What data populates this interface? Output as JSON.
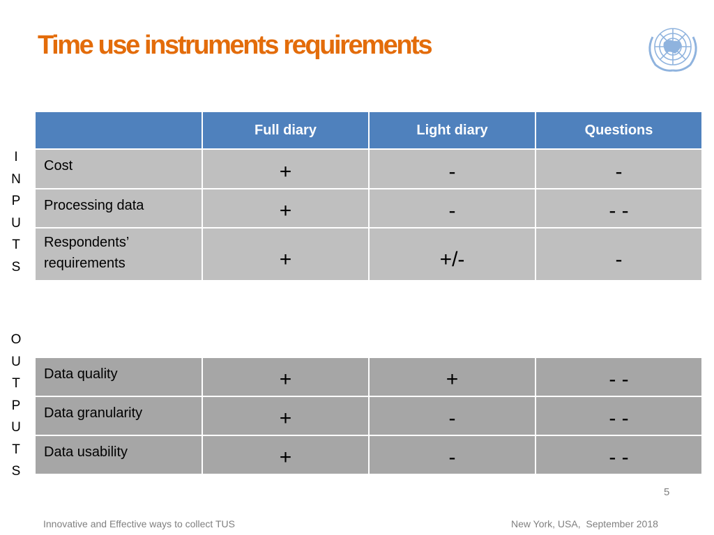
{
  "slide": {
    "title": "Time use instruments requirements",
    "logo_icon": "un-emblem-icon",
    "page_number": "5",
    "footer_left": "Innovative and Effective ways to collect TUS",
    "footer_right": "New York, USA,  September 2018",
    "title_color": "#e36c0a",
    "header_color": "#4f81bd"
  },
  "table": {
    "columns": [
      "",
      "Full diary",
      "Light diary",
      "Questions"
    ],
    "inputs": {
      "side_label": [
        "I",
        "N",
        "P",
        "U",
        "T",
        "S"
      ],
      "rows": [
        {
          "label": "Cost",
          "full": "+",
          "light": "-",
          "questions": "-"
        },
        {
          "label": "Processing data",
          "full": "+",
          "light": "-",
          "questions": "- -"
        },
        {
          "label": "Respondents’ requirements",
          "full": "+",
          "light": "+/-",
          "questions": "-"
        }
      ]
    },
    "outputs": {
      "side_label": [
        "O",
        "U",
        "T",
        "P",
        "U",
        "T",
        "S"
      ],
      "rows": [
        {
          "label": "Data quality",
          "full": "+",
          "light": "+",
          "questions": "- -"
        },
        {
          "label": "Data granularity",
          "full": "+",
          "light": "-",
          "questions": "- -"
        },
        {
          "label": "Data usability",
          "full": "+",
          "light": "-",
          "questions": "- -"
        }
      ]
    }
  }
}
